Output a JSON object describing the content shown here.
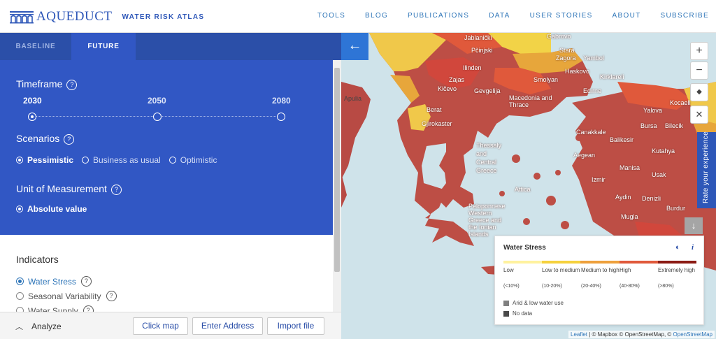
{
  "header": {
    "logo_text": "AQUEDUCT",
    "logo_sub": "WATER RISK ATLAS",
    "nav": [
      "TOOLS",
      "BLOG",
      "PUBLICATIONS",
      "DATA",
      "USER STORIES",
      "ABOUT",
      "SUBSCRIBE"
    ]
  },
  "sidebar": {
    "tabs": [
      "BASELINE",
      "FUTURE"
    ],
    "active_tab": "FUTURE",
    "timeframe": {
      "title": "Timeframe",
      "help": "?",
      "options": [
        "2030",
        "2050",
        "2080"
      ],
      "selected": "2030"
    },
    "scenarios": {
      "title": "Scenarios",
      "help": "?",
      "options": [
        "Pessimistic",
        "Business as usual",
        "Optimistic"
      ],
      "selected": "Pessimistic"
    },
    "unit": {
      "title": "Unit of Measurement",
      "help": "?",
      "options": [
        "Absolute value"
      ],
      "selected": "Absolute value"
    },
    "indicators": {
      "title": "Indicators",
      "items": [
        "Water Stress",
        "Seasonal Variability",
        "Water Supply"
      ],
      "selected": "Water Stress",
      "help": "?"
    },
    "bottom": {
      "analyze_label": "Analyze",
      "chevron": "chevron-up-icon",
      "buttons": [
        "Click map",
        "Enter Address",
        "Import file"
      ]
    }
  },
  "map": {
    "collapse_icon": "arrow-left-icon",
    "controls": [
      "+",
      "−"
    ],
    "rate_label": "Rate your experience",
    "labels": [
      "Jablanički",
      "Gabrovo",
      "Pčinjski",
      "Stara",
      "Zagora",
      "Yambol",
      "Ilinden",
      "Haskovo",
      "Kirklareli",
      "Zajas",
      "Kičevo",
      "Smolyan",
      "Gevgelija",
      "Macedonia and Thrace",
      "Edirne",
      "Berat",
      "Gjirokaster",
      "Kocaeli",
      "Yalova",
      "Bursa",
      "Bilecik",
      "Apulia",
      "Canakkale",
      "Balikesir",
      "Kutahya",
      "Thessaly and Central Greece",
      "Aegean",
      "Manisa",
      "Usak",
      "Peloponnese Western Greece and the Ionian Islands",
      "Attica",
      "Izmir",
      "Aydin",
      "Denizli",
      "Mugla",
      "Burdur"
    ],
    "attribution": {
      "leaflet": "Leaflet",
      "rest": " | © Mapbox © OpenStreetMap, © ",
      "osm": "OpenStreetMap"
    }
  },
  "legend": {
    "title": "Water Stress",
    "info": "i",
    "colors": [
      "#fff29e",
      "#f5d13d",
      "#eea03c",
      "#e0593b",
      "#b62a1e",
      "#8b1a13"
    ],
    "categories": [
      {
        "label": "Low",
        "range": "(<10%)"
      },
      {
        "label": "Low to medium",
        "range": "(10-20%)"
      },
      {
        "label": "Medium to high",
        "range": "(20-40%)"
      },
      {
        "label": "High",
        "range": "(40-80%)"
      },
      {
        "label": "Extremely high",
        "range": "(>80%)"
      }
    ],
    "extra": [
      {
        "label": "Arid & low water use",
        "color": "#808080"
      },
      {
        "label": "No data",
        "color": "#4a4a4a"
      }
    ]
  }
}
